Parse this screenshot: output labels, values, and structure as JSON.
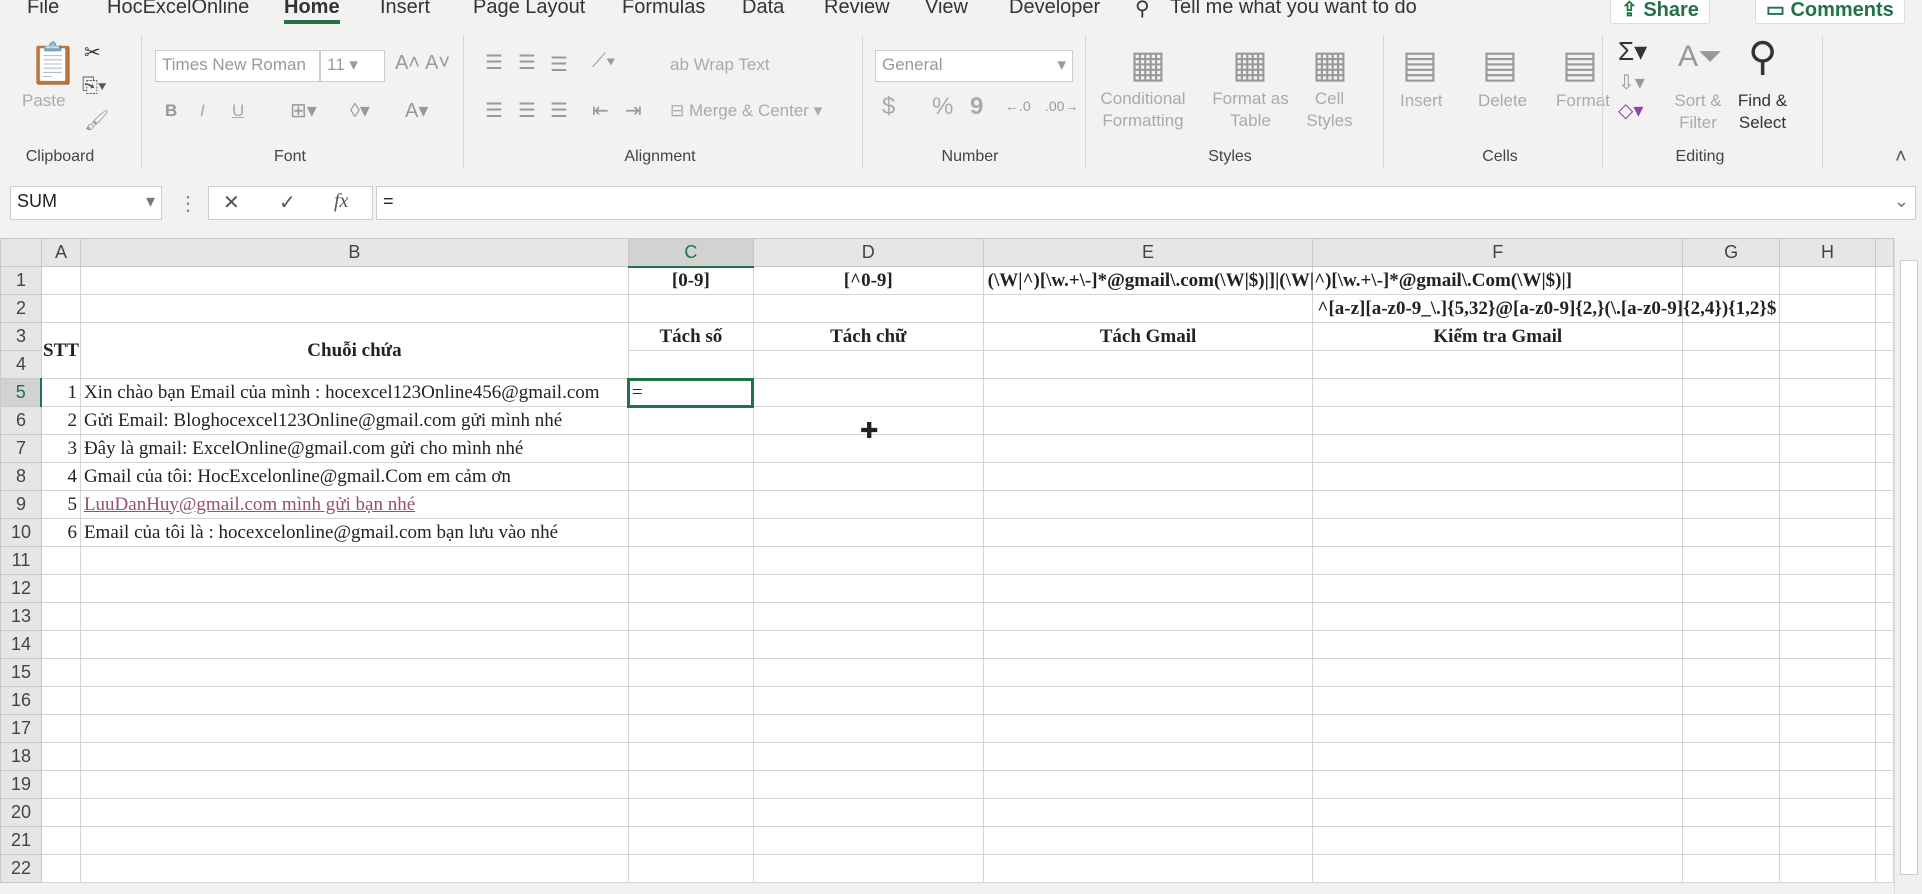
{
  "ribbon_tabs": [
    "File",
    "HocExcelOnline",
    "Home",
    "Insert",
    "Page Layout",
    "Formulas",
    "Data",
    "Review",
    "View",
    "Developer"
  ],
  "tell_me": "Tell me what you want to do",
  "share": "Share",
  "comments": "Comments",
  "clipboard": {
    "paste": "Paste",
    "label": "Clipboard"
  },
  "font": {
    "name": "Times New Roman",
    "size": "11",
    "label": "Font",
    "bold": "B",
    "italic": "I",
    "underline": "U"
  },
  "alignment": {
    "wrap": "Wrap Text",
    "merge": "Merge & Center",
    "label": "Alignment"
  },
  "number": {
    "format": "General",
    "currency": "$",
    "percent": "%",
    "comma": "9",
    "label": "Number"
  },
  "styles": {
    "conditional": "Conditional Formatting",
    "format_table": "Format as Table",
    "cell_styles": "Cell Styles",
    "label": "Styles"
  },
  "cells": {
    "insert": "Insert",
    "delete": "Delete",
    "format": "Format",
    "label": "Cells"
  },
  "editing": {
    "sort": "Sort & Filter",
    "find": "Find & Select",
    "label": "Editing"
  },
  "name_box": "SUM",
  "formula": "=",
  "columns": [
    "A",
    "B",
    "C",
    "D",
    "E",
    "F",
    "G",
    "H"
  ],
  "cells_data": {
    "C1": "[0-9]",
    "D1": "[^0-9]",
    "E1": "(\\W|^)[\\w.+\\-]*@gmail\\.com(\\W|$)|]|(\\W|^)[\\w.+\\-]*@gmail\\.Com(\\W|$)|]",
    "F2": "^[a-z][a-z0-9_\\.]{5,32}@[a-z0-9]{2,}(\\.[a-z0-9]{2,4}){1,2}$",
    "A3": "STT",
    "B3": "Chuỗi chứa",
    "C3": "Tách số",
    "D3": "Tách chữ",
    "E3": "Tách Gmail",
    "F3": "Kiểm tra Gmail",
    "C5": "="
  },
  "rows": [
    {
      "stt": "1",
      "text": "Xin chào bạn Email của mình : hocexcel123Online456@gmail.com"
    },
    {
      "stt": "2",
      "text": "Gửi Email: Bloghocexcel123Online@gmail.com gửi mình nhé"
    },
    {
      "stt": "3",
      "text": "Đây là gmail: ExcelOnline@gmail.com gửi cho mình nhé"
    },
    {
      "stt": "4",
      "text": "Gmail của tôi: HocExcelonline@gmail.Com em cảm ơn"
    },
    {
      "stt": "5",
      "text": "LuuDanHuy@gmail.com mình gửi bạn nhé",
      "link": true
    },
    {
      "stt": "6",
      "text": "Email của tôi là : hocexcelonline@gmail.com bạn lưu vào nhé"
    }
  ],
  "row_count": 22
}
